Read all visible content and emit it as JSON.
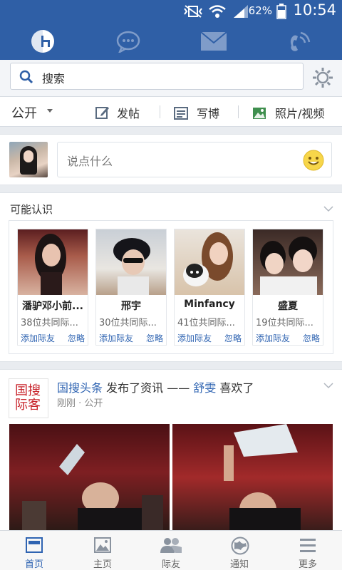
{
  "status": {
    "battery_pct": "62%",
    "time": "10:54"
  },
  "search": {
    "placeholder": "搜索"
  },
  "actions": {
    "visibility": "公开",
    "post": "发帖",
    "blog": "写博",
    "photo": "照片/视频"
  },
  "composer": {
    "placeholder": "说点什么"
  },
  "pymk": {
    "title": "可能认识",
    "people": [
      {
        "name": "潘驴邓小前...",
        "mutual": "38位共同际...",
        "add": "添加际友",
        "ignore": "忽略"
      },
      {
        "name": "邢宇",
        "mutual": "30位共同际...",
        "add": "添加际友",
        "ignore": "忽略"
      },
      {
        "name": "Minfancy",
        "mutual": "41位共同际...",
        "add": "添加际友",
        "ignore": "忽略"
      },
      {
        "name": "盛夏",
        "mutual": "19位共同际...",
        "add": "添加际友",
        "ignore": "忽略"
      }
    ]
  },
  "feed": {
    "logo_text": "国搜际客",
    "author": "国搜头条",
    "action": "发布了资讯 ——",
    "liker": "舒雯",
    "liked": "喜欢了",
    "time": "刚刚",
    "visibility": "公开"
  },
  "bottom_tabs": [
    {
      "label": "首页",
      "icon": "home-icon"
    },
    {
      "label": "主页",
      "icon": "profile-photo-icon"
    },
    {
      "label": "际友",
      "icon": "friends-icon"
    },
    {
      "label": "通知",
      "icon": "globe-icon"
    },
    {
      "label": "更多",
      "icon": "menu-icon"
    }
  ],
  "colors": {
    "brand_blue": "#2f5fa6",
    "link_blue": "#2f64b2",
    "accent_red": "#c8242b"
  }
}
